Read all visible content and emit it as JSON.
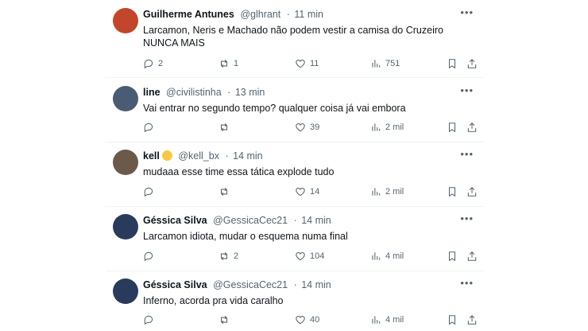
{
  "tweets": [
    {
      "name": "Guilherme Antunes",
      "handle": "@glhrant",
      "time": "11 min",
      "text": "Larcamon, Neris e Machado não podem vestir a camisa do Cruzeiro NUNCA MAIS",
      "replies": "2",
      "retweets": "1",
      "likes": "11",
      "views": "751",
      "avatar_color": "#c2462b"
    },
    {
      "name": "line",
      "handle": "@civilistinha",
      "time": "13 min",
      "text": "Vai entrar no segundo tempo? qualquer coisa já vai embora",
      "replies": "",
      "retweets": "",
      "likes": "39",
      "views": "2 mil",
      "avatar_color": "#4a5c73"
    },
    {
      "name": "kell",
      "name_emoji": "face-emoji",
      "handle": "@kell_bx",
      "time": "14 min",
      "text": "mudaaa esse time essa tática explode tudo",
      "replies": "",
      "retweets": "",
      "likes": "14",
      "views": "2 mil",
      "avatar_color": "#6b5a4a"
    },
    {
      "name": "Géssica Silva",
      "handle": "@GessicaCec21",
      "time": "14 min",
      "text": "Larcamon idiota, mudar o esquema numa final",
      "replies": "",
      "retweets": "2",
      "likes": "104",
      "views": "4 mil",
      "avatar_color": "#2a3a5c"
    },
    {
      "name": "Géssica Silva",
      "handle": "@GessicaCec21",
      "time": "14 min",
      "text": "Inferno, acorda pra vida caralho",
      "replies": "",
      "retweets": "",
      "likes": "40",
      "views": "4 mil",
      "avatar_color": "#2a3a5c"
    }
  ],
  "separator": "·",
  "more_glyph": "•••"
}
